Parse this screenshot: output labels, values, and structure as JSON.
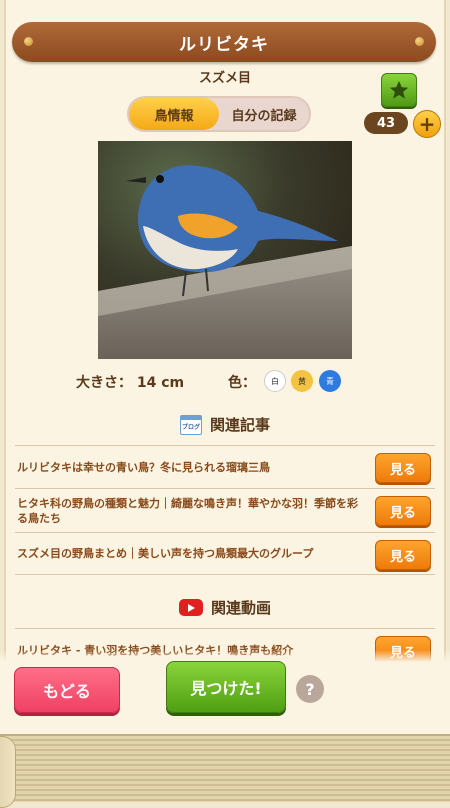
{
  "header": {
    "title": "ルリビタキ",
    "order": "スズメ目"
  },
  "stats": {
    "count": "43",
    "plus": "+"
  },
  "tabs": [
    {
      "label": "鳥情報",
      "active": true
    },
    {
      "label": "自分の記録",
      "active": false
    }
  ],
  "bird": {
    "size_label": "大きさ：",
    "size_value": "14 cm",
    "color_label": "色：",
    "colors": [
      {
        "label": "白",
        "hex": "#ffffff"
      },
      {
        "label": "黄",
        "hex": "#f5c342"
      },
      {
        "label": "青",
        "hex": "#2f7ae0"
      }
    ]
  },
  "articles": {
    "icon_text": "ブログ",
    "heading": "関連記事",
    "items": [
      "ルリビタキは幸せの青い鳥？冬に見られる瑠璃三鳥",
      "ヒタキ科の野鳥の種類と魅力｜綺麗な鳴き声！華やかな羽！季節を彩る鳥たち",
      "スズメ目の野鳥まとめ｜美しい声を持つ鳥類最大のグループ"
    ],
    "see_label": "見る"
  },
  "videos": {
    "heading": "関連動画",
    "items": [
      "ルリビタキ - 青い羽を持つ美しいヒタキ！鳴き声も紹介"
    ],
    "see_label": "見る"
  },
  "footer": {
    "back_label": "もどる",
    "found_label": "見つけた!",
    "help_label": "?"
  },
  "colors": {
    "brand_brown": "#8c4a1f",
    "accent_orange": "#ee7a0a",
    "green": "#4e9f12",
    "pink": "#f04063"
  }
}
